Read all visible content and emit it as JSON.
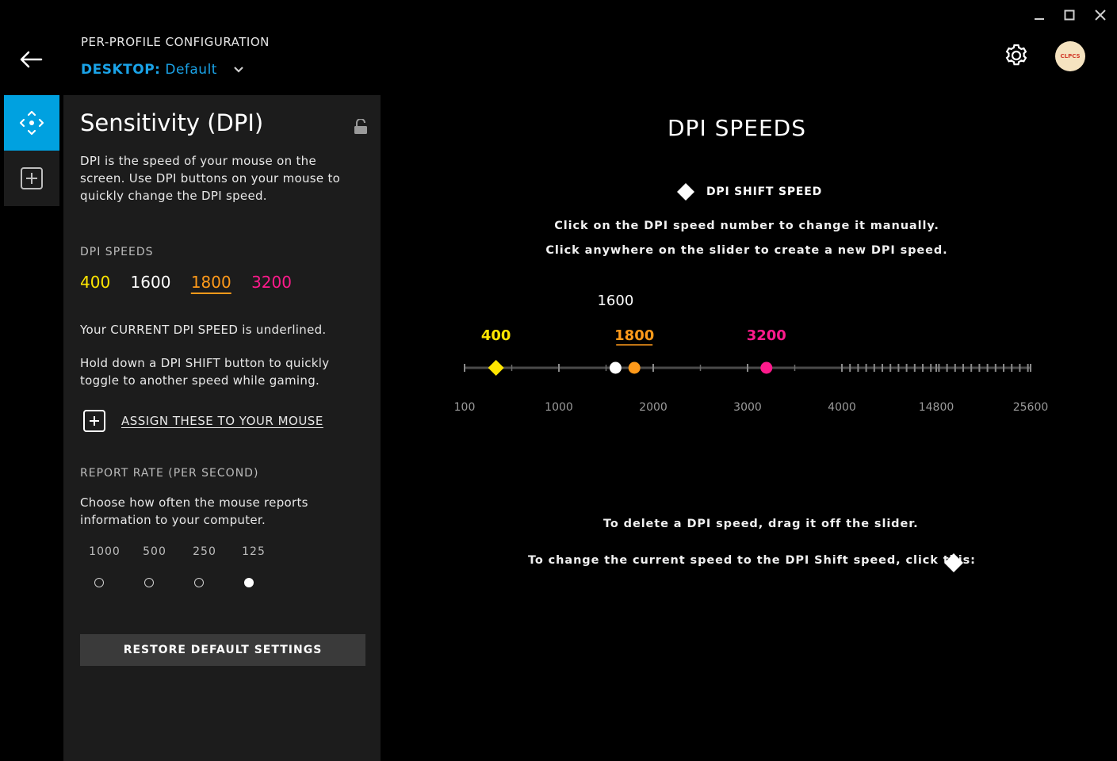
{
  "window": {
    "minimize_icon": "minimize-icon",
    "maximize_icon": "maximize-icon",
    "close_icon": "close-icon"
  },
  "header": {
    "config_label": "PER-PROFILE CONFIGURATION",
    "profile_prefix": "DESKTOP:",
    "profile_name": "Default",
    "avatar_text": "CLPCS"
  },
  "panel": {
    "title": "Sensitivity (DPI)",
    "description": "DPI is the speed of your mouse on the screen. Use DPI buttons on your mouse to quickly change the DPI speed.",
    "dpi_speeds_label": "DPI SPEEDS",
    "speeds": [
      {
        "label": "400",
        "color": "#ffe600"
      },
      {
        "label": "1600",
        "color": "#ffffff"
      },
      {
        "label": "1800",
        "color": "#ff9a1a"
      },
      {
        "label": "3200",
        "color": "#ff1a8c"
      }
    ],
    "current_note": "Your CURRENT DPI SPEED is underlined.",
    "shift_note": "Hold down a DPI SHIFT button to quickly toggle to another speed while gaming.",
    "assign_label": "ASSIGN THESE TO YOUR MOUSE",
    "report_rate_label": "REPORT RATE (PER SECOND)",
    "report_rate_desc": "Choose how often the mouse reports information to your computer.",
    "report_rates": [
      "1000",
      "500",
      "250",
      "125"
    ],
    "selected_rate": "125",
    "restore_label": "RESTORE DEFAULT SETTINGS"
  },
  "main": {
    "title": "DPI SPEEDS",
    "shift_legend": "DPI SHIFT SPEED",
    "instruction_1": "Click on the DPI speed number to change it manually.",
    "instruction_2": "Click anywhere on the slider to create a new DPI speed.",
    "footer_1": "To delete a DPI speed, drag it off the slider.",
    "footer_2": "To change the current speed to the DPI Shift speed, click this:"
  },
  "slider_data": {
    "tick_labels": [
      "100",
      "1000",
      "2000",
      "3000",
      "4000",
      "14800",
      "25600"
    ],
    "markers": [
      {
        "value": 400,
        "label": "400",
        "color": "#ffe600",
        "shape": "diamond",
        "role": "dpi-shift"
      },
      {
        "value": 1600,
        "label": "1600",
        "color": "#ffffff",
        "shape": "circle",
        "role": "normal"
      },
      {
        "value": 1800,
        "label": "1800",
        "color": "#ff9a1a",
        "shape": "circle",
        "role": "current"
      },
      {
        "value": 3200,
        "label": "3200",
        "color": "#ff1a8c",
        "shape": "circle",
        "role": "normal"
      }
    ],
    "current_speed": "1800",
    "shift_speed": "400"
  }
}
